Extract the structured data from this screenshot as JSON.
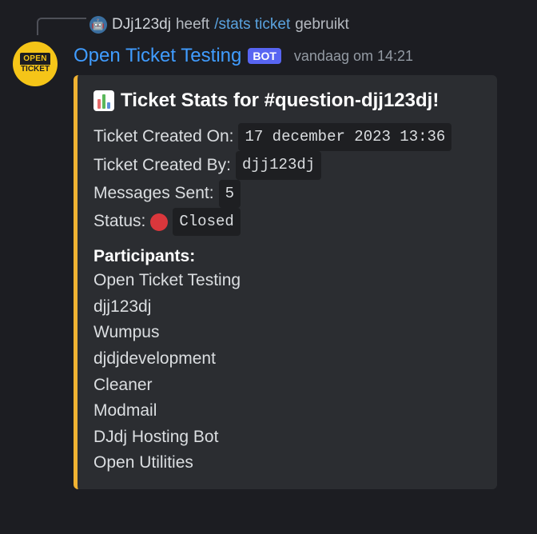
{
  "reply": {
    "user": "DJj123dj",
    "verb": "heeft",
    "command": "/stats ticket",
    "suffix": "gebruikt"
  },
  "header": {
    "bot_name": "Open Ticket Testing",
    "bot_tag": "BOT",
    "timestamp": "vandaag om 14:21"
  },
  "avatar": {
    "top": "OPEN",
    "bottom": "TICKET"
  },
  "embed": {
    "title": "Ticket Stats for #question-djj123dj!",
    "fields": {
      "created_on_label": "Ticket Created On:",
      "created_on_value": "17 december 2023 13:36",
      "created_by_label": "Ticket Created By:",
      "created_by_value": "djj123dj",
      "messages_label": "Messages Sent:",
      "messages_value": "5",
      "status_label": "Status:",
      "status_value": "Closed"
    },
    "participants_header": "Participants:",
    "participants": [
      "Open Ticket Testing",
      "djj123dj",
      "Wumpus",
      "djdjdevelopment",
      "Cleaner",
      "Modmail",
      "DJdj Hosting Bot",
      "Open Utilities"
    ]
  }
}
